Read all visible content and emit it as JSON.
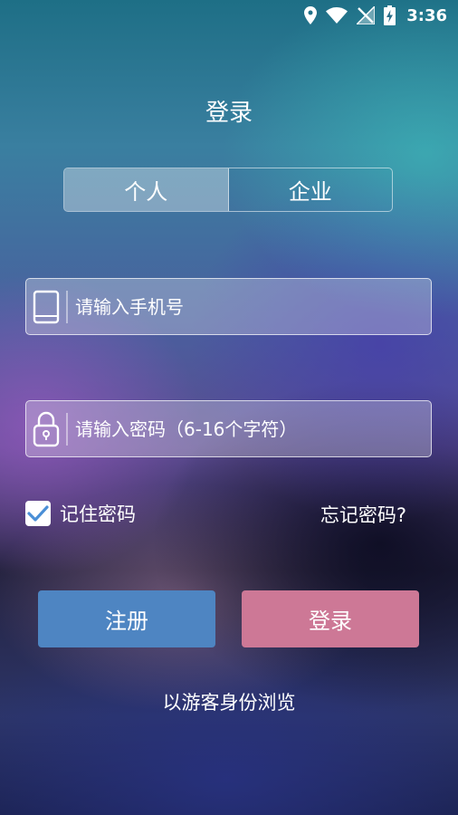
{
  "status_bar": {
    "time": "3:36",
    "icons": [
      "location-icon",
      "wifi-icon",
      "no-signal-icon",
      "battery-charging-icon"
    ]
  },
  "title": "登录",
  "tabs": [
    {
      "label": "个人",
      "active": true
    },
    {
      "label": "企业",
      "active": false
    }
  ],
  "phone_input": {
    "placeholder": "请输入手机号",
    "value": "",
    "icon": "phone-icon"
  },
  "password_input": {
    "placeholder": "请输入密码（6-16个字符）",
    "value": "",
    "icon": "lock-icon"
  },
  "remember": {
    "label": "记住密码",
    "checked": true
  },
  "forgot_label": "忘记密码?",
  "buttons": {
    "register": "注册",
    "login": "登录"
  },
  "guest_label": "以游客身份浏览",
  "colors": {
    "register_button": "#4e85c2",
    "login_button": "#cd7896",
    "checkmark": "#4a8fd6"
  }
}
